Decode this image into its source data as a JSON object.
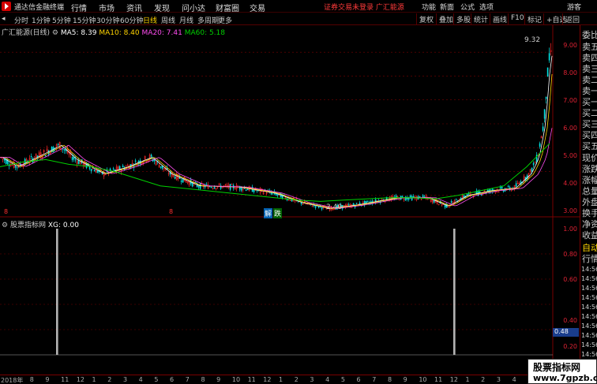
{
  "app": {
    "title": "通达信金融终端"
  },
  "menu": [
    "行情",
    "市场",
    "资讯",
    "发现",
    "问小达",
    "财富圈",
    "交易"
  ],
  "notice": "证券交易未登录  广汇能源",
  "right_menu": [
    "功能",
    "新面",
    "公式",
    "选项",
    "游客"
  ],
  "periods": [
    "分时",
    "1分钟",
    "5分钟",
    "15分钟",
    "30分钟",
    "60分钟",
    "日线",
    "周线",
    "月线",
    "多周期",
    "更多"
  ],
  "active_period": "日线",
  "tools": [
    "复权",
    "叠加",
    "多股",
    "统计",
    "画线",
    "F10",
    "标记",
    "+自选",
    "返回"
  ],
  "main_info": {
    "name": "广汇能源(日线)",
    "ma5": "MA5: 8.39",
    "ma10": "MA10: 8.40",
    "ma20": "MA20: 7.41",
    "ma60": "MA60: 5.18"
  },
  "main_yaxis": [
    "9.00",
    "8.00",
    "7.00",
    "6.00",
    "5.00",
    "4.00",
    "3.00"
  ],
  "annotations": {
    "high": "9.32",
    "low": "2.40",
    "marker1": "解",
    "marker2": "跌",
    "small1": "8",
    "small2": "8"
  },
  "sub_info": {
    "name": "股票指标网",
    "xg": "XG: 0.00"
  },
  "sub_yaxis": [
    "1.00",
    "0.80",
    "0.60",
    "0.40",
    "0.20"
  ],
  "value_tag": "0.48",
  "date_axis": [
    "2018年",
    "8",
    "9",
    "11",
    "12",
    "1",
    "2",
    "3",
    "4",
    "5",
    "6",
    "7",
    "8",
    "9",
    "10",
    "11",
    "12",
    "1",
    "2",
    "3",
    "4",
    "5",
    "6",
    "7",
    "8",
    "9",
    "10",
    "11",
    "12",
    "1",
    "2",
    "3",
    "4",
    "5",
    "6"
  ],
  "right_panel": [
    "委比",
    "卖五",
    "卖四",
    "卖三",
    "卖二",
    "卖一",
    "买一",
    "买二",
    "买三",
    "买四",
    "买五",
    "现价",
    "涨跌",
    "涨幅",
    "总量",
    "外盘",
    "换手",
    "净资",
    "收益",
    "自动",
    "行情"
  ],
  "right_times": [
    "14:56",
    "14:56",
    "14:56",
    "14:56",
    "14:56",
    "14:56",
    "14:56",
    "14:56",
    "14:56",
    "14:56"
  ],
  "watermark": {
    "line1": "股票指标网",
    "line2": "www.7gpzb.com"
  },
  "colors": {
    "up": "#ff2a2a",
    "down": "#00e0e0",
    "ma5": "#ffffff",
    "ma10": "#ffd400",
    "ma20": "#ff4df0",
    "ma60": "#00d000",
    "grid": "#7a0000"
  },
  "chart_data": [
    {
      "type": "line",
      "title": "广汇能源(日线)",
      "ylim": [
        2.2,
        9.8
      ],
      "series": [
        {
          "name": "MA60",
          "values": [
            4.2,
            4.4,
            4.5,
            4.3,
            4.2,
            4.0,
            3.7,
            3.4,
            3.3,
            3.2,
            3.1,
            3.0,
            2.9,
            2.8,
            2.75,
            2.8,
            2.85,
            2.9,
            2.9,
            2.85,
            3.0,
            3.2,
            3.4,
            4.2,
            5.18
          ]
        }
      ],
      "annotations": [
        "9.32",
        "2.40"
      ]
    },
    {
      "type": "bar",
      "title": "股票指标网",
      "ylim": [
        0,
        1.1
      ],
      "signals": [
        {
          "index": "2018-09",
          "value": 1.0
        },
        {
          "index": "2021-02",
          "value": 1.0
        }
      ]
    }
  ]
}
